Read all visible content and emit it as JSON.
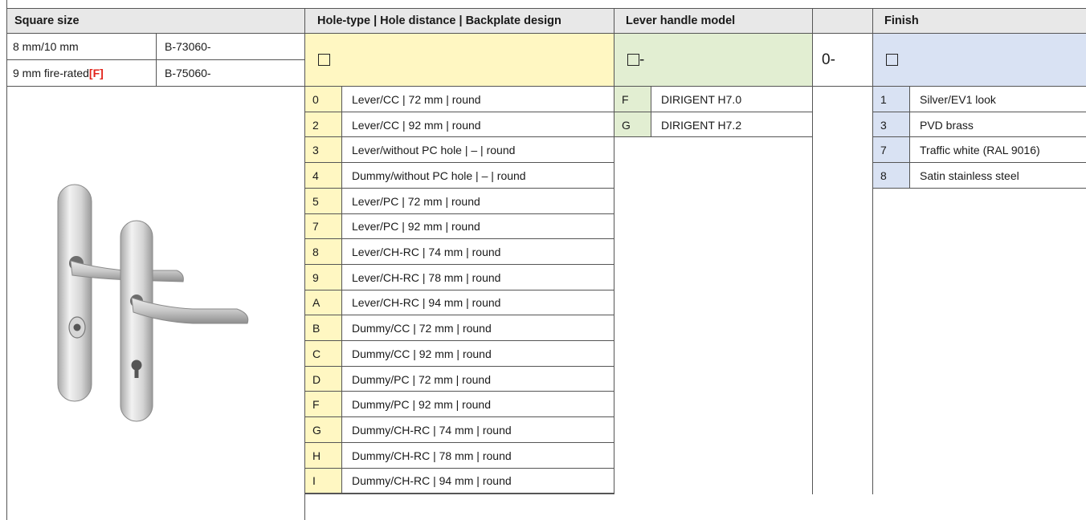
{
  "headers": {
    "square_size": "Square size",
    "hole_type": "Hole-type | Hole distance | Backplate design",
    "lever_model": "Lever handle model",
    "finish": "Finish"
  },
  "square_sizes": [
    {
      "size": "8 mm/10 mm",
      "tag": "",
      "code": "B-73060-"
    },
    {
      "size": "9 mm fire-rated ",
      "tag": "[F]",
      "code": "B-75060-"
    }
  ],
  "selectors": {
    "lever_suffix": "-",
    "fixed_value": "0-"
  },
  "hole_types": [
    {
      "code": "0",
      "label": "Lever/CC | 72 mm | round"
    },
    {
      "code": "2",
      "label": "Lever/CC | 92 mm | round"
    },
    {
      "code": "3",
      "label": "Lever/without PC hole | – | round"
    },
    {
      "code": "4",
      "label": "Dummy/without PC hole | – | round"
    },
    {
      "code": "5",
      "label": "Lever/PC | 72 mm | round"
    },
    {
      "code": "7",
      "label": "Lever/PC | 92 mm | round"
    },
    {
      "code": "8",
      "label": "Lever/CH-RC | 74 mm | round"
    },
    {
      "code": "9",
      "label": "Lever/CH-RC | 78 mm | round"
    },
    {
      "code": "A",
      "label": "Lever/CH-RC | 94 mm | round"
    },
    {
      "code": "B",
      "label": "Dummy/CC | 72 mm | round"
    },
    {
      "code": "C",
      "label": "Dummy/CC | 92 mm | round"
    },
    {
      "code": "D",
      "label": "Dummy/PC | 72 mm | round"
    },
    {
      "code": "F",
      "label": "Dummy/PC | 92 mm | round"
    },
    {
      "code": "G",
      "label": "Dummy/CH-RC | 74 mm | round"
    },
    {
      "code": "H",
      "label": "Dummy/CH-RC | 78 mm | round"
    },
    {
      "code": "I",
      "label": "Dummy/CH-RC | 94 mm | round"
    }
  ],
  "lever_models": [
    {
      "code": "F",
      "label": "DIRIGENT H7.0"
    },
    {
      "code": "G",
      "label": "DIRIGENT H7.2"
    }
  ],
  "finishes": [
    {
      "code": "1",
      "label": "Silver/EV1 look"
    },
    {
      "code": "3",
      "label": "PVD brass"
    },
    {
      "code": "7",
      "label": "Traffic white (RAL 9016)"
    },
    {
      "code": "8",
      "label": "Satin stainless steel"
    }
  ],
  "colors": {
    "header_bg": "#e8e8e8",
    "hole_bg": "#fff7c2",
    "lever_bg": "#e2eed2",
    "finish_bg": "#d9e2f3",
    "accent_red": "#e2231a"
  },
  "image": {
    "alt": "door-lever-handle-set-photo"
  }
}
